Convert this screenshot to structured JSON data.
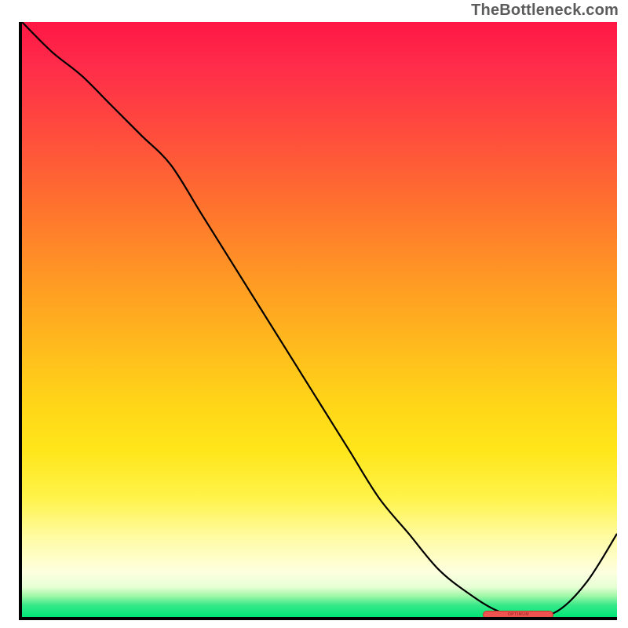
{
  "attribution": "TheBottleneck.com",
  "chart_data": {
    "type": "line",
    "x": [
      0,
      5,
      10,
      15,
      20,
      25,
      30,
      35,
      40,
      45,
      50,
      55,
      60,
      65,
      70,
      75,
      80,
      85,
      90,
      95,
      100
    ],
    "series": [
      {
        "name": "bottleneck-curve",
        "values": [
          100,
          95,
          91,
          86,
          81,
          76,
          68,
          60,
          52,
          44,
          36,
          28,
          20,
          14,
          8,
          4,
          1,
          0,
          1,
          6,
          14
        ]
      }
    ],
    "xlim": [
      0,
      100
    ],
    "ylim": [
      0,
      100
    ],
    "xlabel": "",
    "ylabel": "",
    "title": "",
    "gradient_stops": [
      {
        "pos": 0,
        "color": "#ff1744"
      },
      {
        "pos": 50,
        "color": "#ffd518"
      },
      {
        "pos": 90,
        "color": "#fdffe0"
      },
      {
        "pos": 100,
        "color": "#00e676"
      }
    ],
    "marker": {
      "label": "OPTIMUM",
      "x_center": 83,
      "y": 0.5
    }
  }
}
